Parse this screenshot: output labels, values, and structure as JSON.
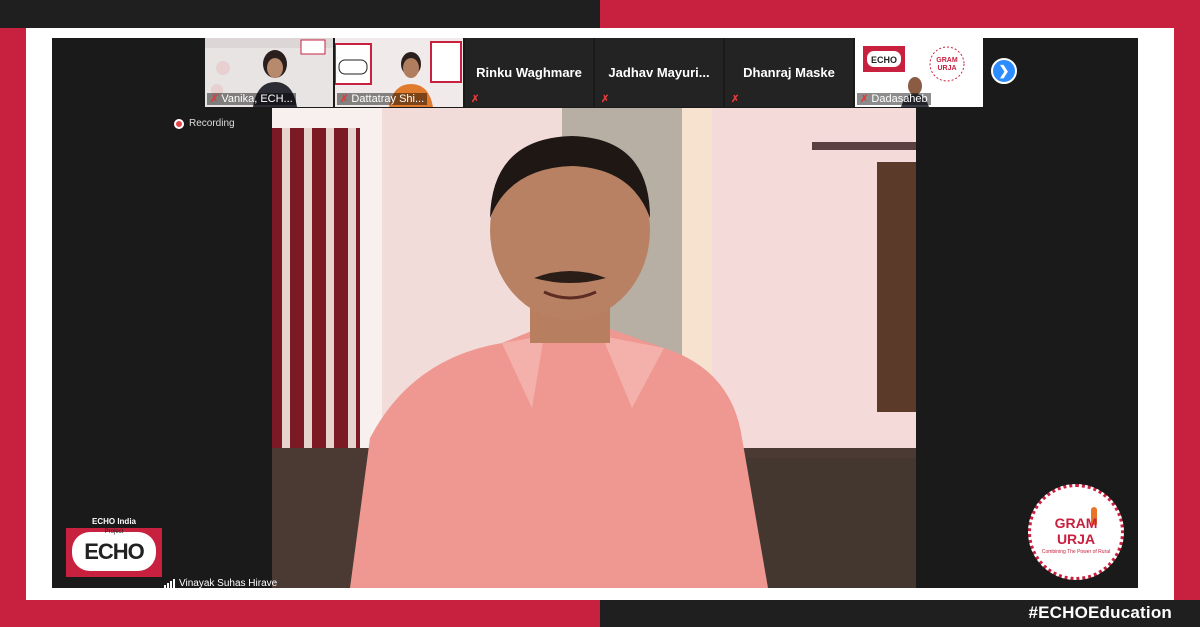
{
  "meeting": {
    "recording_label": "Recording",
    "speaker_name": "Vinayak Suhas Hirave",
    "next_page_icon": "chevron-right-icon"
  },
  "participants": [
    {
      "name": "Vanika, ECH...",
      "has_video": true,
      "muted": true
    },
    {
      "name": "Dattatray Shi...",
      "has_video": true,
      "muted": true
    },
    {
      "name": "Rinku Waghmare",
      "has_video": false,
      "muted": true
    },
    {
      "name": "Jadhav  Mayuri...",
      "has_video": false,
      "muted": true
    },
    {
      "name": "Dhanraj Maske",
      "has_video": false,
      "muted": true
    },
    {
      "name": "Dadasaheb",
      "has_video": true,
      "muted": true
    }
  ],
  "branding": {
    "echo_india": "ECHO India",
    "echo_project": "Project",
    "echo_logo_text": "ECHO",
    "gram_line1": "GRAM",
    "gram_line2": "URJA",
    "gram_tagline": "Combining The Power of Rural",
    "hashtag": "#ECHOEducation"
  },
  "colors": {
    "brand_red": "#c8203f",
    "dark": "#1f1f1f",
    "zoom_blue": "#2d8cff",
    "mic_off_red": "#e23b3b"
  }
}
